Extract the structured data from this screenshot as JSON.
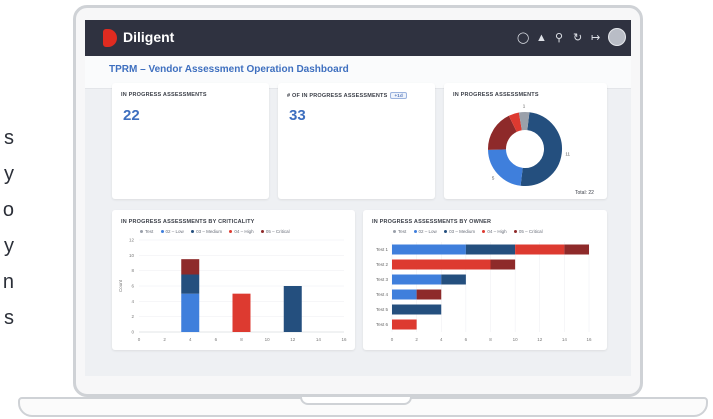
{
  "side_letters": [
    "s",
    "y",
    "o",
    "y",
    "n",
    "s"
  ],
  "app": {
    "brand": "Diligent"
  },
  "topbar_icons": [
    "chat-icon",
    "bell-icon",
    "search-icon",
    "refresh-icon",
    "logout-icon",
    "avatar"
  ],
  "page": {
    "title": "TPRM – Vendor Assessment Operation Dashboard"
  },
  "kpi1": {
    "title": "IN PROGRESS ASSESSMENTS",
    "value": "22"
  },
  "kpi2": {
    "title": "# OF IN PROGRESS ASSESSMENTS",
    "tag": "+1d",
    "value": "33"
  },
  "donut": {
    "title": "IN PROGRESS ASSESSMENTS",
    "total": "Total: 22"
  },
  "criticality": {
    "title": "IN PROGRESS ASSESSMENTS BY CRITICALITY"
  },
  "owner": {
    "title": "IN PROGRESS ASSESSMENTS BY OWNER"
  },
  "legend": [
    {
      "label": "Test",
      "color": "#9aa0aa"
    },
    {
      "label": "02 – Low",
      "color": "#3f7fdc"
    },
    {
      "label": "03 – Medium",
      "color": "#244f7e"
    },
    {
      "label": "04 – High",
      "color": "#dd3a30"
    },
    {
      "label": "05 – Critical",
      "color": "#8e2a2a"
    }
  ],
  "chart_data": [
    {
      "type": "pie",
      "title": "IN PROGRESS ASSESSMENTS",
      "categories": [
        "03 – Medium",
        "02 – Low",
        "05 – Critical",
        "04 – High",
        "Test"
      ],
      "values": [
        11,
        5,
        4,
        1,
        1
      ],
      "colors": [
        "#244f7e",
        "#3f7fdc",
        "#8e2a2a",
        "#dd3a30",
        "#9aa0aa"
      ],
      "labels": [
        "11",
        "5",
        "",
        "",
        "1"
      ],
      "annotation": "Total: 22"
    },
    {
      "type": "bar",
      "title": "IN PROGRESS ASSESSMENTS BY CRITICALITY",
      "ylabel": "Count",
      "ylim": [
        0,
        12
      ],
      "yticks": [
        0,
        2,
        4,
        6,
        8,
        10,
        12
      ],
      "xlim": [
        0,
        16
      ],
      "xticks": [
        0,
        2,
        4,
        6,
        8,
        10,
        12,
        14,
        16
      ],
      "x": [
        4,
        8,
        12
      ],
      "series": [
        {
          "name": "02 – Low",
          "color": "#3f7fdc",
          "values": [
            5,
            0,
            0
          ]
        },
        {
          "name": "03 – Medium",
          "color": "#244f7e",
          "values": [
            2.5,
            0,
            6
          ]
        },
        {
          "name": "04 – High",
          "color": "#dd3a30",
          "values": [
            0,
            5,
            0
          ]
        },
        {
          "name": "05 – Critical",
          "color": "#8e2a2a",
          "values": [
            2,
            0,
            0
          ]
        }
      ],
      "legend": "top"
    },
    {
      "type": "bar",
      "orientation": "horizontal",
      "title": "IN PROGRESS ASSESSMENTS BY OWNER",
      "categories": [
        "Test 1",
        "Test 2",
        "Test 3",
        "Test 4",
        "Test 5",
        "Test 6"
      ],
      "xlim": [
        0,
        16
      ],
      "xticks": [
        0,
        2,
        4,
        6,
        8,
        10,
        12,
        14,
        16
      ],
      "series": [
        {
          "name": "02 – Low",
          "color": "#3f7fdc",
          "values": [
            6,
            0,
            4,
            2,
            0,
            0
          ]
        },
        {
          "name": "03 – Medium",
          "color": "#244f7e",
          "values": [
            4,
            0,
            2,
            0,
            4,
            0
          ]
        },
        {
          "name": "04 – High",
          "color": "#dd3a30",
          "values": [
            4,
            8,
            0,
            0,
            0,
            2
          ]
        },
        {
          "name": "05 – Critical",
          "color": "#8e2a2a",
          "values": [
            2,
            2,
            0,
            2,
            0,
            0
          ]
        }
      ],
      "legend": "top"
    }
  ]
}
